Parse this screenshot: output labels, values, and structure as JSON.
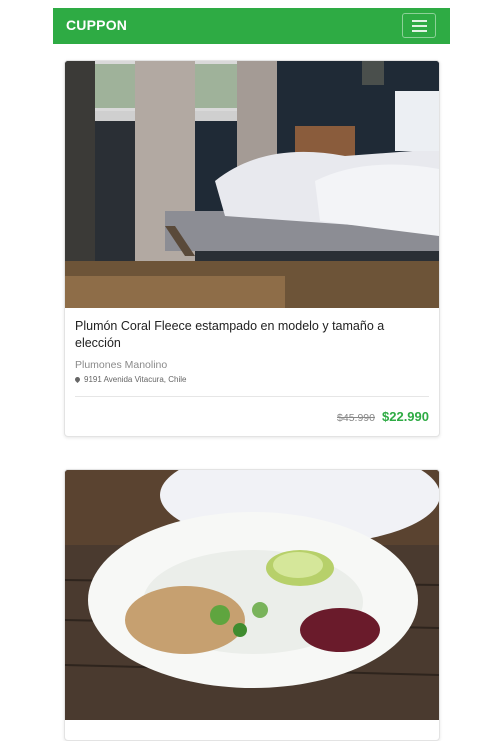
{
  "header": {
    "brand": "CUPPON",
    "menu_icon": "hamburger-menu-icon",
    "color": "#2eab44"
  },
  "deals": [
    {
      "image": "bedroom-bed-photo",
      "title": "Plumón Coral Fleece estampado en modelo y tamaño a elección",
      "merchant": "Plumones Manolino",
      "address": "9191 Avenida Vitacura, Chile",
      "old_price": "$45.990",
      "new_price": "$22.990"
    },
    {
      "image": "salad-plate-photo"
    }
  ]
}
